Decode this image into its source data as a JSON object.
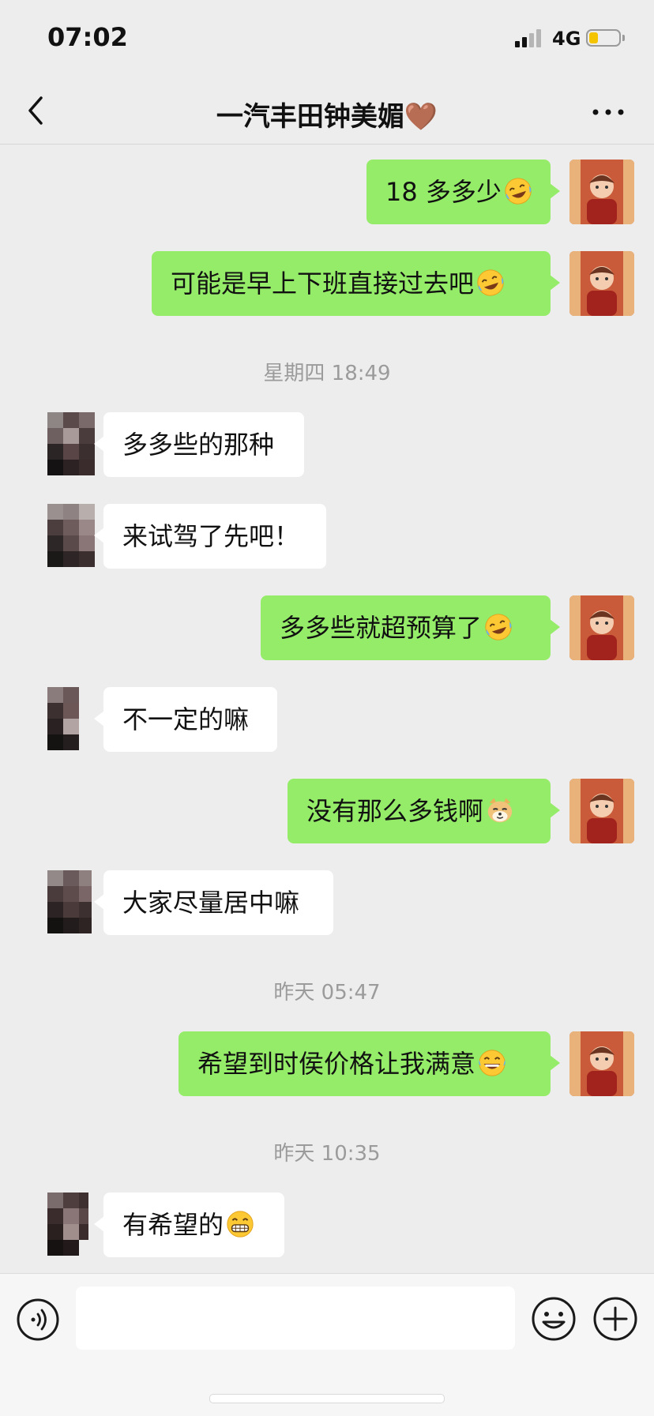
{
  "status_bar": {
    "time": "07:02",
    "network": "4G",
    "battery_level": 0.2
  },
  "header": {
    "title": "一汽丰田钟美媚🤎"
  },
  "messages": [
    {
      "text": "18 多多少",
      "emoji": "laugh-tears"
    },
    {
      "text": "可能是早上下班直接过去吧",
      "emoji": "laugh-tears"
    },
    {
      "timestamp": "星期四 18:49"
    },
    {
      "text": "多多些的那种"
    },
    {
      "text": "来试驾了先吧！"
    },
    {
      "text": "多多些就超预算了",
      "emoji": "laugh-tears"
    },
    {
      "text": "不一定的嘛"
    },
    {
      "text": "没有那么多钱啊",
      "emoji": "doge"
    },
    {
      "text": "大家尽量居中嘛"
    },
    {
      "timestamp": "昨天 05:47"
    },
    {
      "text": "希望到时侯价格让我满意",
      "emoji": "grin-sweat"
    },
    {
      "timestamp": "昨天 10:35"
    },
    {
      "text": "有希望的",
      "emoji": "grin"
    }
  ],
  "composer": {
    "input_value": ""
  },
  "colors": {
    "outgoing_bubble": "#95ec69",
    "incoming_bubble": "#ffffff",
    "background": "#ededed"
  }
}
